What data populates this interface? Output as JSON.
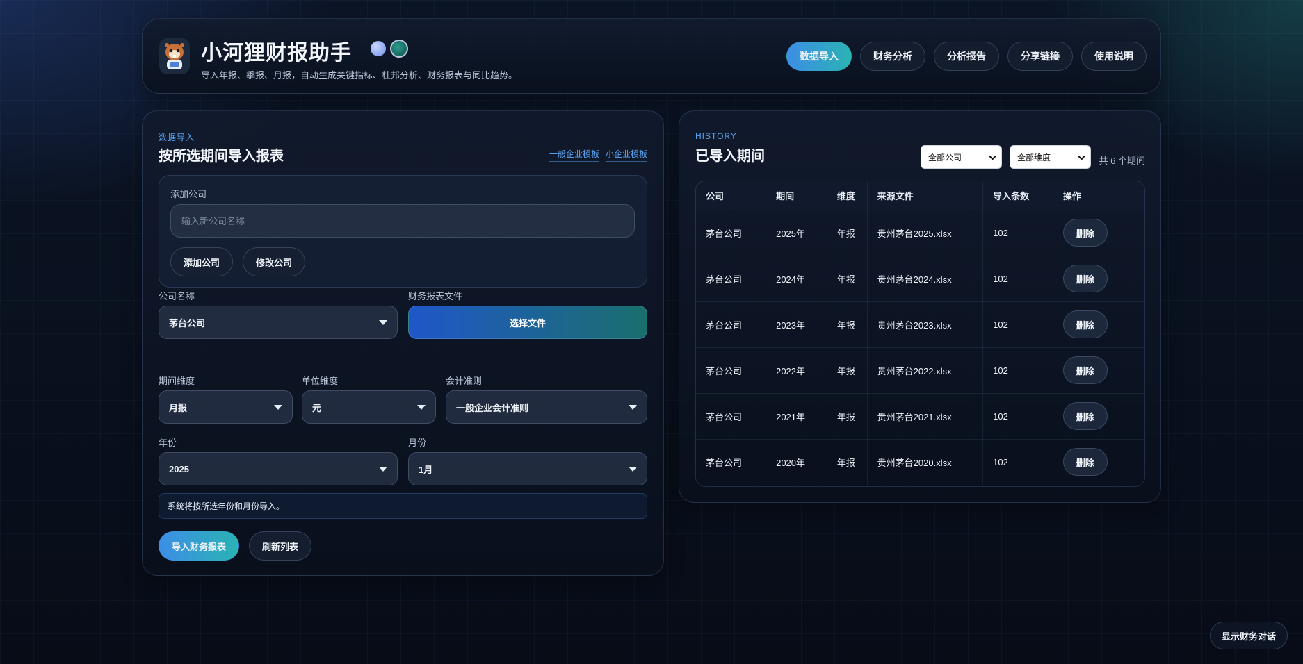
{
  "app": {
    "title": "小河狸财报助手",
    "subtitle": "导入年报、季报、月报，自动生成关键指标、杜邦分析、财务报表与同比趋势。"
  },
  "nav": {
    "items": [
      {
        "label": "数据导入",
        "active": true
      },
      {
        "label": "财务分析",
        "active": false
      },
      {
        "label": "分析报告",
        "active": false
      },
      {
        "label": "分享链接",
        "active": false
      },
      {
        "label": "使用说明",
        "active": false
      }
    ]
  },
  "import_panel": {
    "eyebrow": "数据导入",
    "title": "按所选期间导入报表",
    "template_general": "一般企业模板",
    "template_small": "小企业模板",
    "add_company_label": "添加公司",
    "new_company_placeholder": "输入新公司名称",
    "add_company_button": "添加公司",
    "edit_company_button": "修改公司",
    "company_name_label": "公司名称",
    "company_name_value": "茅台公司",
    "file_label": "财务报表文件",
    "file_button": "选择文件",
    "period_label": "期间维度",
    "period_value": "月报",
    "unit_label": "单位维度",
    "unit_value": "元",
    "standard_label": "会计准则",
    "standard_value": "一般企业会计准则",
    "year_label": "年份",
    "year_value": "2025",
    "month_label": "月份",
    "month_value": "1月",
    "hint": "系统将按所选年份和月份导入。",
    "import_button": "导入财务报表",
    "refresh_button": "刷新列表"
  },
  "history_panel": {
    "eyebrow": "HISTORY",
    "title": "已导入期间",
    "company_filter": "全部公司",
    "dimension_filter": "全部维度",
    "count_text": "共 6 个期间",
    "columns": [
      "公司",
      "期间",
      "维度",
      "来源文件",
      "导入条数",
      "操作"
    ],
    "delete_label": "删除",
    "rows": [
      {
        "company": "茅台公司",
        "period": "2025年",
        "dimension": "年报",
        "file": "贵州茅台2025.xlsx",
        "count": "102"
      },
      {
        "company": "茅台公司",
        "period": "2024年",
        "dimension": "年报",
        "file": "贵州茅台2024.xlsx",
        "count": "102"
      },
      {
        "company": "茅台公司",
        "period": "2023年",
        "dimension": "年报",
        "file": "贵州茅台2023.xlsx",
        "count": "102"
      },
      {
        "company": "茅台公司",
        "period": "2022年",
        "dimension": "年报",
        "file": "贵州茅台2022.xlsx",
        "count": "102"
      },
      {
        "company": "茅台公司",
        "period": "2021年",
        "dimension": "年报",
        "file": "贵州茅台2021.xlsx",
        "count": "102"
      },
      {
        "company": "茅台公司",
        "period": "2020年",
        "dimension": "年报",
        "file": "贵州茅台2020.xlsx",
        "count": "102"
      }
    ]
  },
  "chat_button": "显示财务对话",
  "colors": {
    "accent_start": "#3d8ee6",
    "accent_end": "#2ab3b3",
    "link": "#5aa2f0",
    "background": "#070c17"
  },
  "icons": {
    "logo": "beaver-mascot-icon",
    "theme_light": "theme-light-dot-icon",
    "theme_dark": "theme-dark-dot-icon",
    "caret": "chevron-down-icon"
  }
}
